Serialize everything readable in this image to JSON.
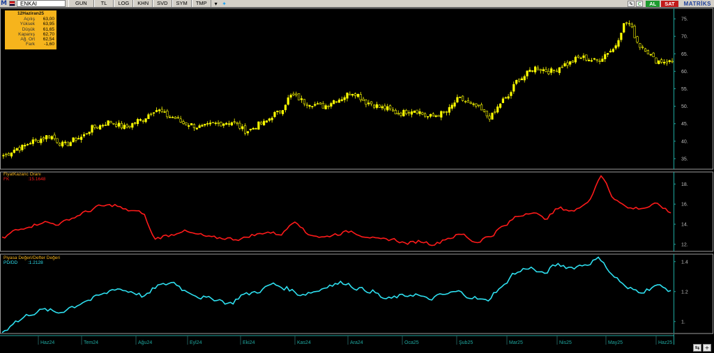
{
  "toolbar": {
    "symbol": "ENKAI",
    "buttons": [
      "GUN",
      "TL",
      "LOG",
      "KHN",
      "SVD",
      "SYM",
      "TMP"
    ],
    "buy_label": "AL",
    "sell_label": "SAT",
    "brand": "MATRİKS"
  },
  "info_box": {
    "date": "12Haziran25",
    "rows": [
      {
        "label": "Açılış",
        "value": "63,00"
      },
      {
        "label": "Yüksek",
        "value": "63,95"
      },
      {
        "label": "Düşük",
        "value": "61,65"
      },
      {
        "label": "Kapanış",
        "value": "62,70"
      },
      {
        "label": "Ağ. Ort",
        "value": "62,54"
      },
      {
        "label": "Fark",
        "value": "-1,60"
      }
    ]
  },
  "pane2": {
    "title": "FiyatKazanc Oranı",
    "series_label": "FK",
    "series_value": ":15.1648"
  },
  "pane3": {
    "title": "Piyasa Değeri/Defter Değeri",
    "series_label": "PD/DD",
    "series_value": ":1.2128"
  },
  "colors": {
    "price": "#ffff00",
    "fk": "#ff1a1a",
    "pddd": "#2ee0f0",
    "axis": "#1fa8a0",
    "grid_sep": "#9b9b9b"
  },
  "chart_data": [
    {
      "type": "candlestick",
      "title": "",
      "series": [
        {
          "name": "ENKAI"
        }
      ],
      "y_ticks": [
        "35.",
        "40.",
        "45.",
        "50.",
        "55.",
        "60.",
        "65.",
        "70.",
        "75."
      ],
      "ylim": [
        32,
        78
      ],
      "x_ticks": [
        "Haz24",
        "Tem24",
        "Ağu24",
        "Eyl24",
        "Eki24",
        "Kas24",
        "Ara24",
        "Oca25",
        "Şub25",
        "Mar25",
        "Nis25",
        "May25",
        "Haz25"
      ],
      "x": [
        "Haz24",
        "Tem24",
        "Ağu24",
        "Eyl24",
        "Eki24",
        "Kas24",
        "Ara24",
        "Oca25",
        "Şub25",
        "Mar25",
        "Nis25",
        "May25",
        "Haz25"
      ],
      "close": [
        38.5,
        41.0,
        45.0,
        48.5,
        44.5,
        51.0,
        53.0,
        48.0,
        47.5,
        53.0,
        62.0,
        66.0,
        62.7
      ]
    },
    {
      "type": "line",
      "title": "FiyatKazanc Oranı",
      "series": [
        {
          "name": "FK"
        }
      ],
      "y_ticks": [
        "12.",
        "14.",
        "16.",
        "18."
      ],
      "ylim": [
        11.3,
        19.2
      ],
      "x": [
        "Haz24",
        "Tem24",
        "Ağu24",
        "Eyl24",
        "Eki24",
        "Kas24",
        "Ara24",
        "Oca25",
        "Şub25",
        "Mar25",
        "Nis25",
        "May25",
        "Haz25"
      ],
      "values": [
        13.5,
        14.0,
        15.8,
        12.9,
        12.5,
        13.2,
        13.3,
        12.4,
        12.2,
        13.5,
        15.5,
        16.0,
        15.16
      ]
    },
    {
      "type": "line",
      "title": "Piyasa Değeri/Defter Değeri",
      "series": [
        {
          "name": "PD/DD"
        }
      ],
      "y_ticks": [
        "1.",
        "1.2",
        "1.4"
      ],
      "ylim": [
        0.92,
        1.45
      ],
      "x": [
        "Haz24",
        "Tem24",
        "Ağu24",
        "Eyl24",
        "Eki24",
        "Kas24",
        "Ara24",
        "Oca25",
        "Şub25",
        "Mar25",
        "Nis25",
        "May25",
        "Haz25"
      ],
      "values": [
        1.0,
        1.08,
        1.18,
        1.24,
        1.16,
        1.24,
        1.25,
        1.18,
        1.17,
        1.24,
        1.38,
        1.4,
        1.21
      ]
    }
  ]
}
